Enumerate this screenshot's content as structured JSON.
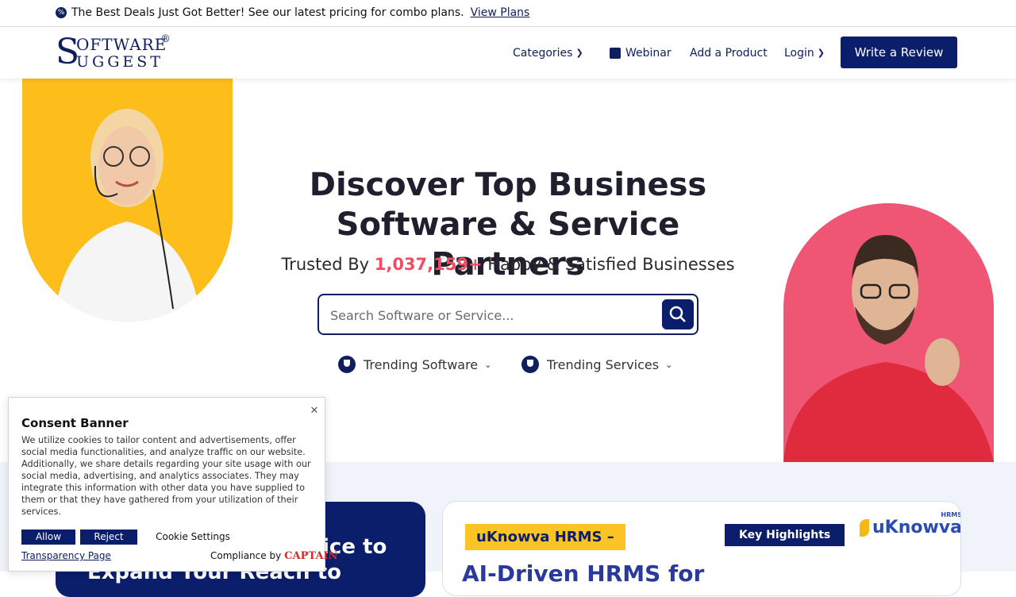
{
  "promo_bar": {
    "icon": "percent-badge-icon",
    "text": "The Best Deals Just Got Better! See our latest pricing for combo plans.",
    "link": "View Plans"
  },
  "header": {
    "logo": {
      "s": "S",
      "line1": "OFTWARE",
      "line2": "UGGEST",
      "reg": "®"
    },
    "nav": {
      "categories": "Categories",
      "webinar": "Webinar",
      "add_product": "Add a Product",
      "login": "Login",
      "write_review": "Write a Review"
    }
  },
  "hero": {
    "title_line1": "Discover Top Business",
    "title_line2": "Software & Service Partners",
    "sub_prefix": "Trusted By ",
    "sub_count": "1,037,159+",
    "sub_suffix": " Happy & Satisfied Businesses",
    "search_placeholder": "Search Software or Service...",
    "trending_software": "Trending Software",
    "trending_services": "Trending Services"
  },
  "cards": {
    "left_line1": "ice to",
    "left_line2": "Expand Your Reach to",
    "uk_title": "uKnowva HRMS –",
    "uk_sub": "AI-Driven HRMS for",
    "key_highlights": "Key Highlights",
    "uk_logo": "uKnowva",
    "uk_logo_tag": "HRMS"
  },
  "consent": {
    "title": "Consent Banner",
    "body": "We utilize cookies to tailor content and advertisements, offer social media functionalities, and analyze traffic on our website. Additionally, we share details regarding your site usage with our social media, advertising, and analytics associates. They may integrate this information with other data you have supplied to them or that they have gathered from your utilization of their services.",
    "allow": "Allow",
    "reject": "Reject",
    "settings": "Cookie Settings",
    "transparency": "Transparency Page",
    "compliance": "Compliance by",
    "captain": "CAPTAIN"
  },
  "colors": {
    "navy": "#0a1e6b",
    "accent_red": "#ef4e63",
    "yellow": "#fdbd1a",
    "pink": "#ef5673"
  }
}
